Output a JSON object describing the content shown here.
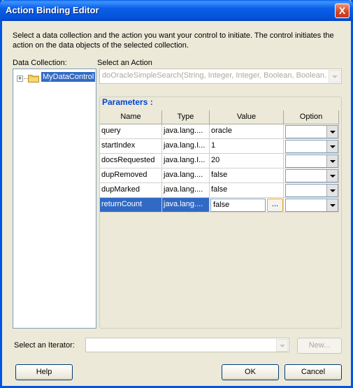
{
  "window": {
    "title": "Action Binding Editor",
    "close_glyph": "X"
  },
  "description": "Select a data collection and the action you want your control to initiate. The control initiates the action on the data objects of the selected collection.",
  "data_collection": {
    "label": "Data Collection:",
    "tree": [
      {
        "label": "MyDataControl",
        "expanded": false,
        "selected": true
      }
    ]
  },
  "action": {
    "label": "Select an Action",
    "value": "doOracleSimpleSearch(String, Integer, Integer, Boolean, Boolean..."
  },
  "parameters": {
    "title": "Parameters :",
    "columns": [
      "Name",
      "Type",
      "Value",
      "Option"
    ],
    "rows": [
      {
        "name": "query",
        "type": "java.lang....",
        "value": "oracle"
      },
      {
        "name": "startIndex",
        "type": "java.lang.I...",
        "value": "1"
      },
      {
        "name": "docsRequested",
        "type": "java.lang.I...",
        "value": "20"
      },
      {
        "name": "dupRemoved",
        "type": "java.lang....",
        "value": "false"
      },
      {
        "name": "dupMarked",
        "type": "java.lang....",
        "value": "false"
      },
      {
        "name": "returnCount",
        "type": "java.lang....",
        "value": "false",
        "selected": true,
        "editing": true
      }
    ],
    "ellipsis_label": "..."
  },
  "iterator": {
    "label": "Select an Iterator:",
    "value": "",
    "new_label": "New..."
  },
  "buttons": {
    "help": "Help",
    "ok": "OK",
    "cancel": "Cancel"
  },
  "colors": {
    "title_bar": "#0a5fe8",
    "selection": "#316ac5",
    "section_title": "#0046d5"
  },
  "icons": {
    "tree_node": "folder-icon",
    "expand": "plus-expander-icon",
    "close": "close-icon"
  }
}
